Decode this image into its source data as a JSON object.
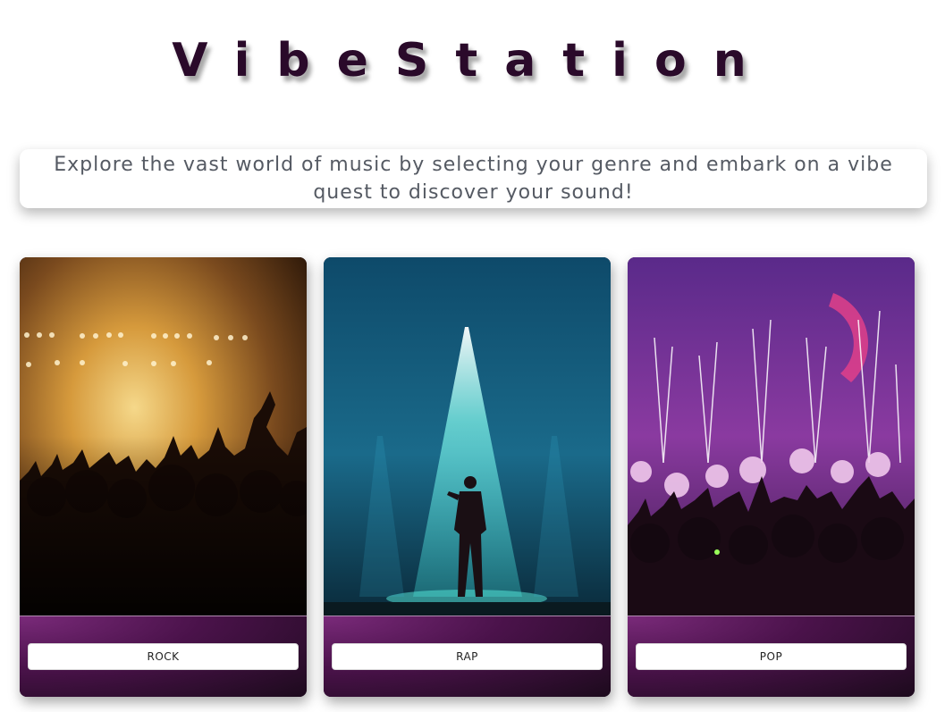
{
  "brand": {
    "title": "VibeStation"
  },
  "intro": {
    "text": "Explore the vast world of music by selecting your genre and embark on a vibe quest to discover your sound!"
  },
  "genres": [
    {
      "label": "ROCK",
      "image": "rock-concert-crowd-image"
    },
    {
      "label": "RAP",
      "image": "rap-performer-spotlight-image"
    },
    {
      "label": "POP",
      "image": "pop-concert-fireworks-image"
    }
  ],
  "colors": {
    "brand_text": "#2a0a2a",
    "card_footer_accent": "#7a2a7a",
    "tagline_text": "#555a63"
  }
}
